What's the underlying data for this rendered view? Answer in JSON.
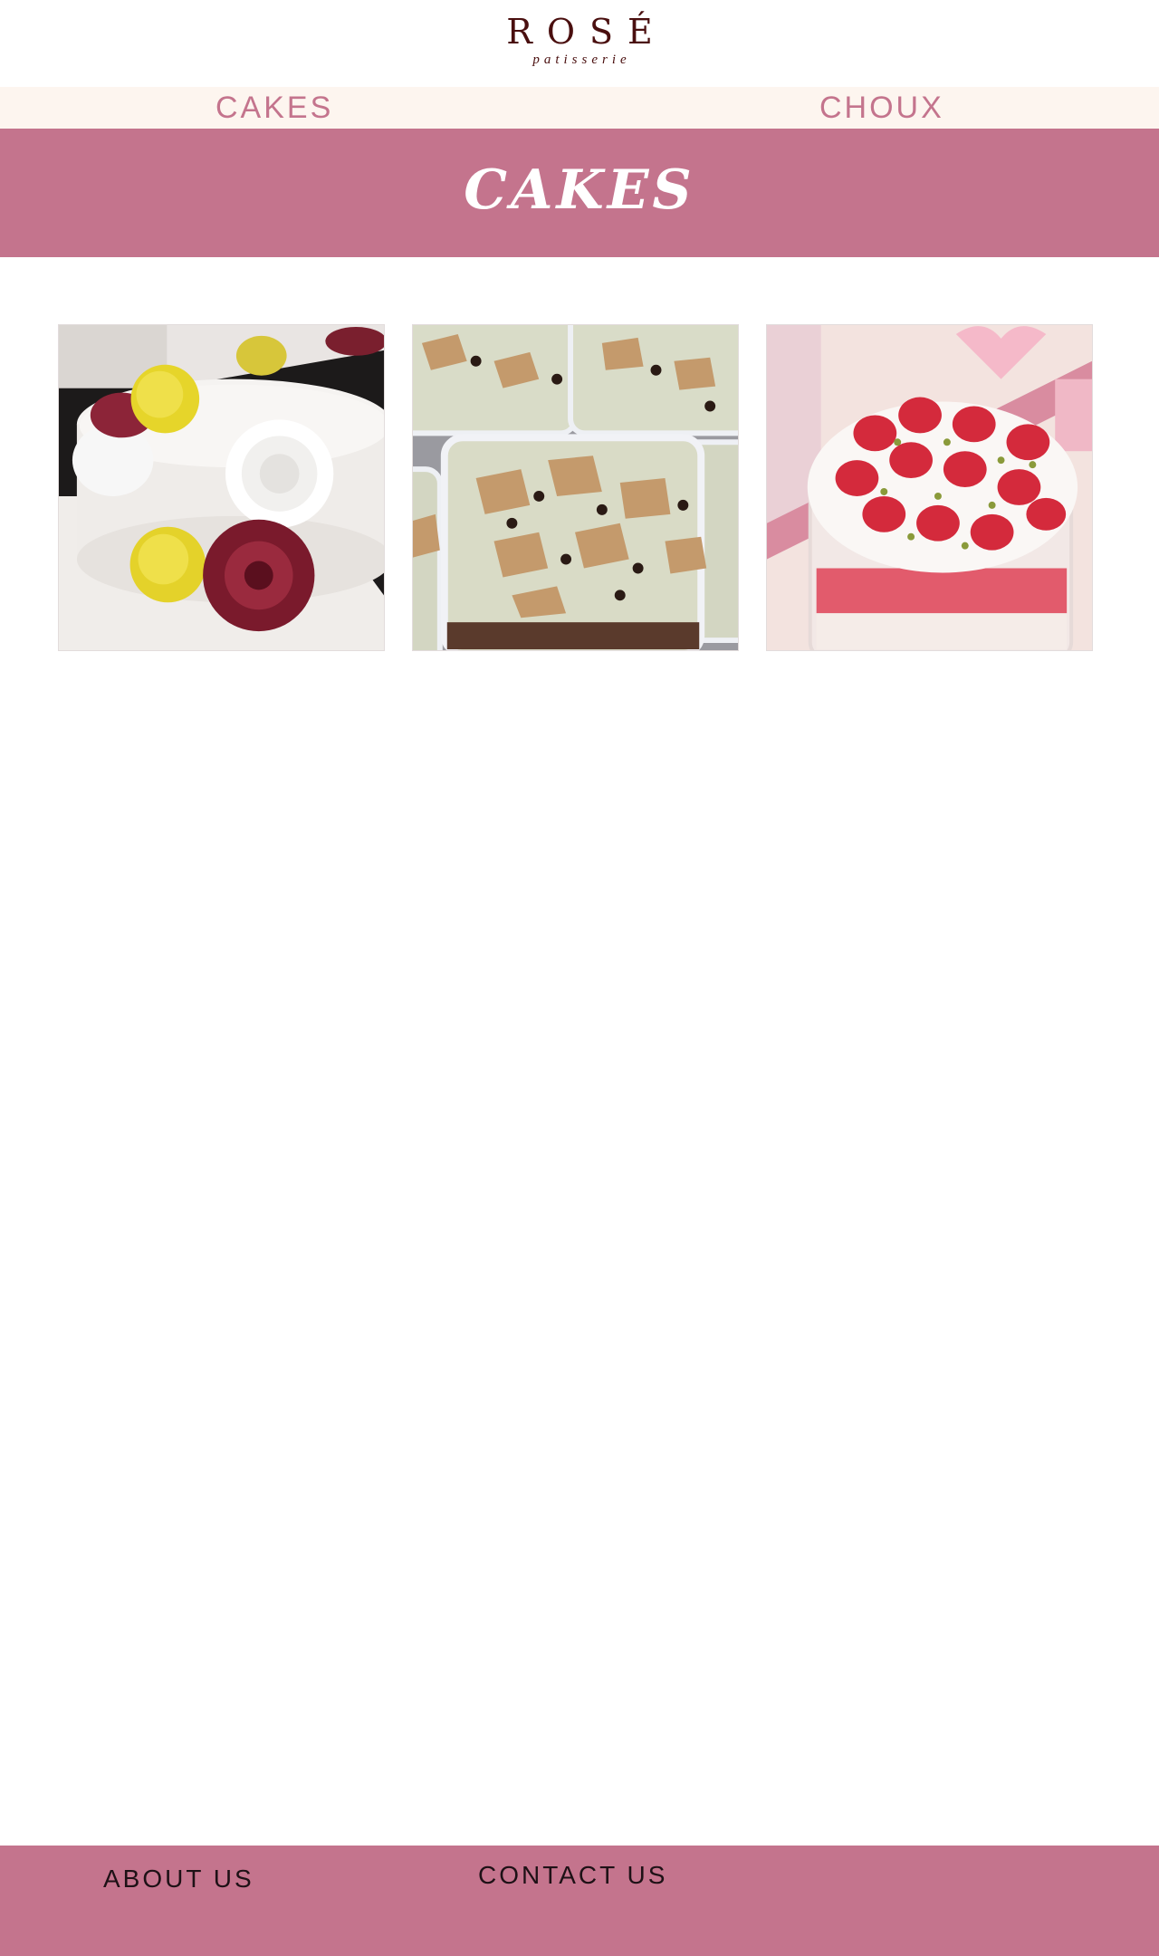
{
  "brand": {
    "name": "ROSÉ",
    "tagline": "patisserie",
    "color": "#4a0f0f"
  },
  "nav": {
    "items": [
      {
        "label": "CAKES"
      },
      {
        "label": "CHOUX"
      }
    ]
  },
  "banner": {
    "title": "CAKES",
    "color": "#c4748d"
  },
  "products": [
    {
      "image": "white-flower-cake-image"
    },
    {
      "image": "cookie-crumble-cake-boxes-image"
    },
    {
      "image": "strawberry-cake-box-image"
    }
  ],
  "footer": {
    "links": [
      {
        "label": "ABOUT US"
      },
      {
        "label": "CONTACT US"
      }
    ]
  },
  "colors": {
    "accent": "#c4748d",
    "nav_bg": "#fdf5ef"
  }
}
